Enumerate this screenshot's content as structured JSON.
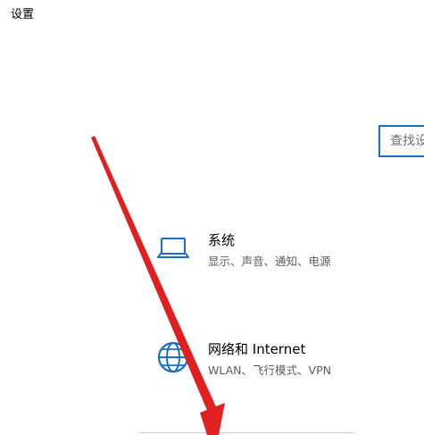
{
  "window": {
    "title": "设置"
  },
  "search": {
    "placeholder": "查找设"
  },
  "settings": {
    "items": [
      {
        "title": "系统",
        "subtitle": "显示、声音、通知、电源",
        "icon": "laptop-icon"
      },
      {
        "title": "网络和 Internet",
        "subtitle": "WLAN、飞行模式、VPN",
        "icon": "globe-icon"
      }
    ]
  },
  "colors": {
    "accent": "#1a6fc4",
    "annotation_arrow": "#e02020"
  }
}
